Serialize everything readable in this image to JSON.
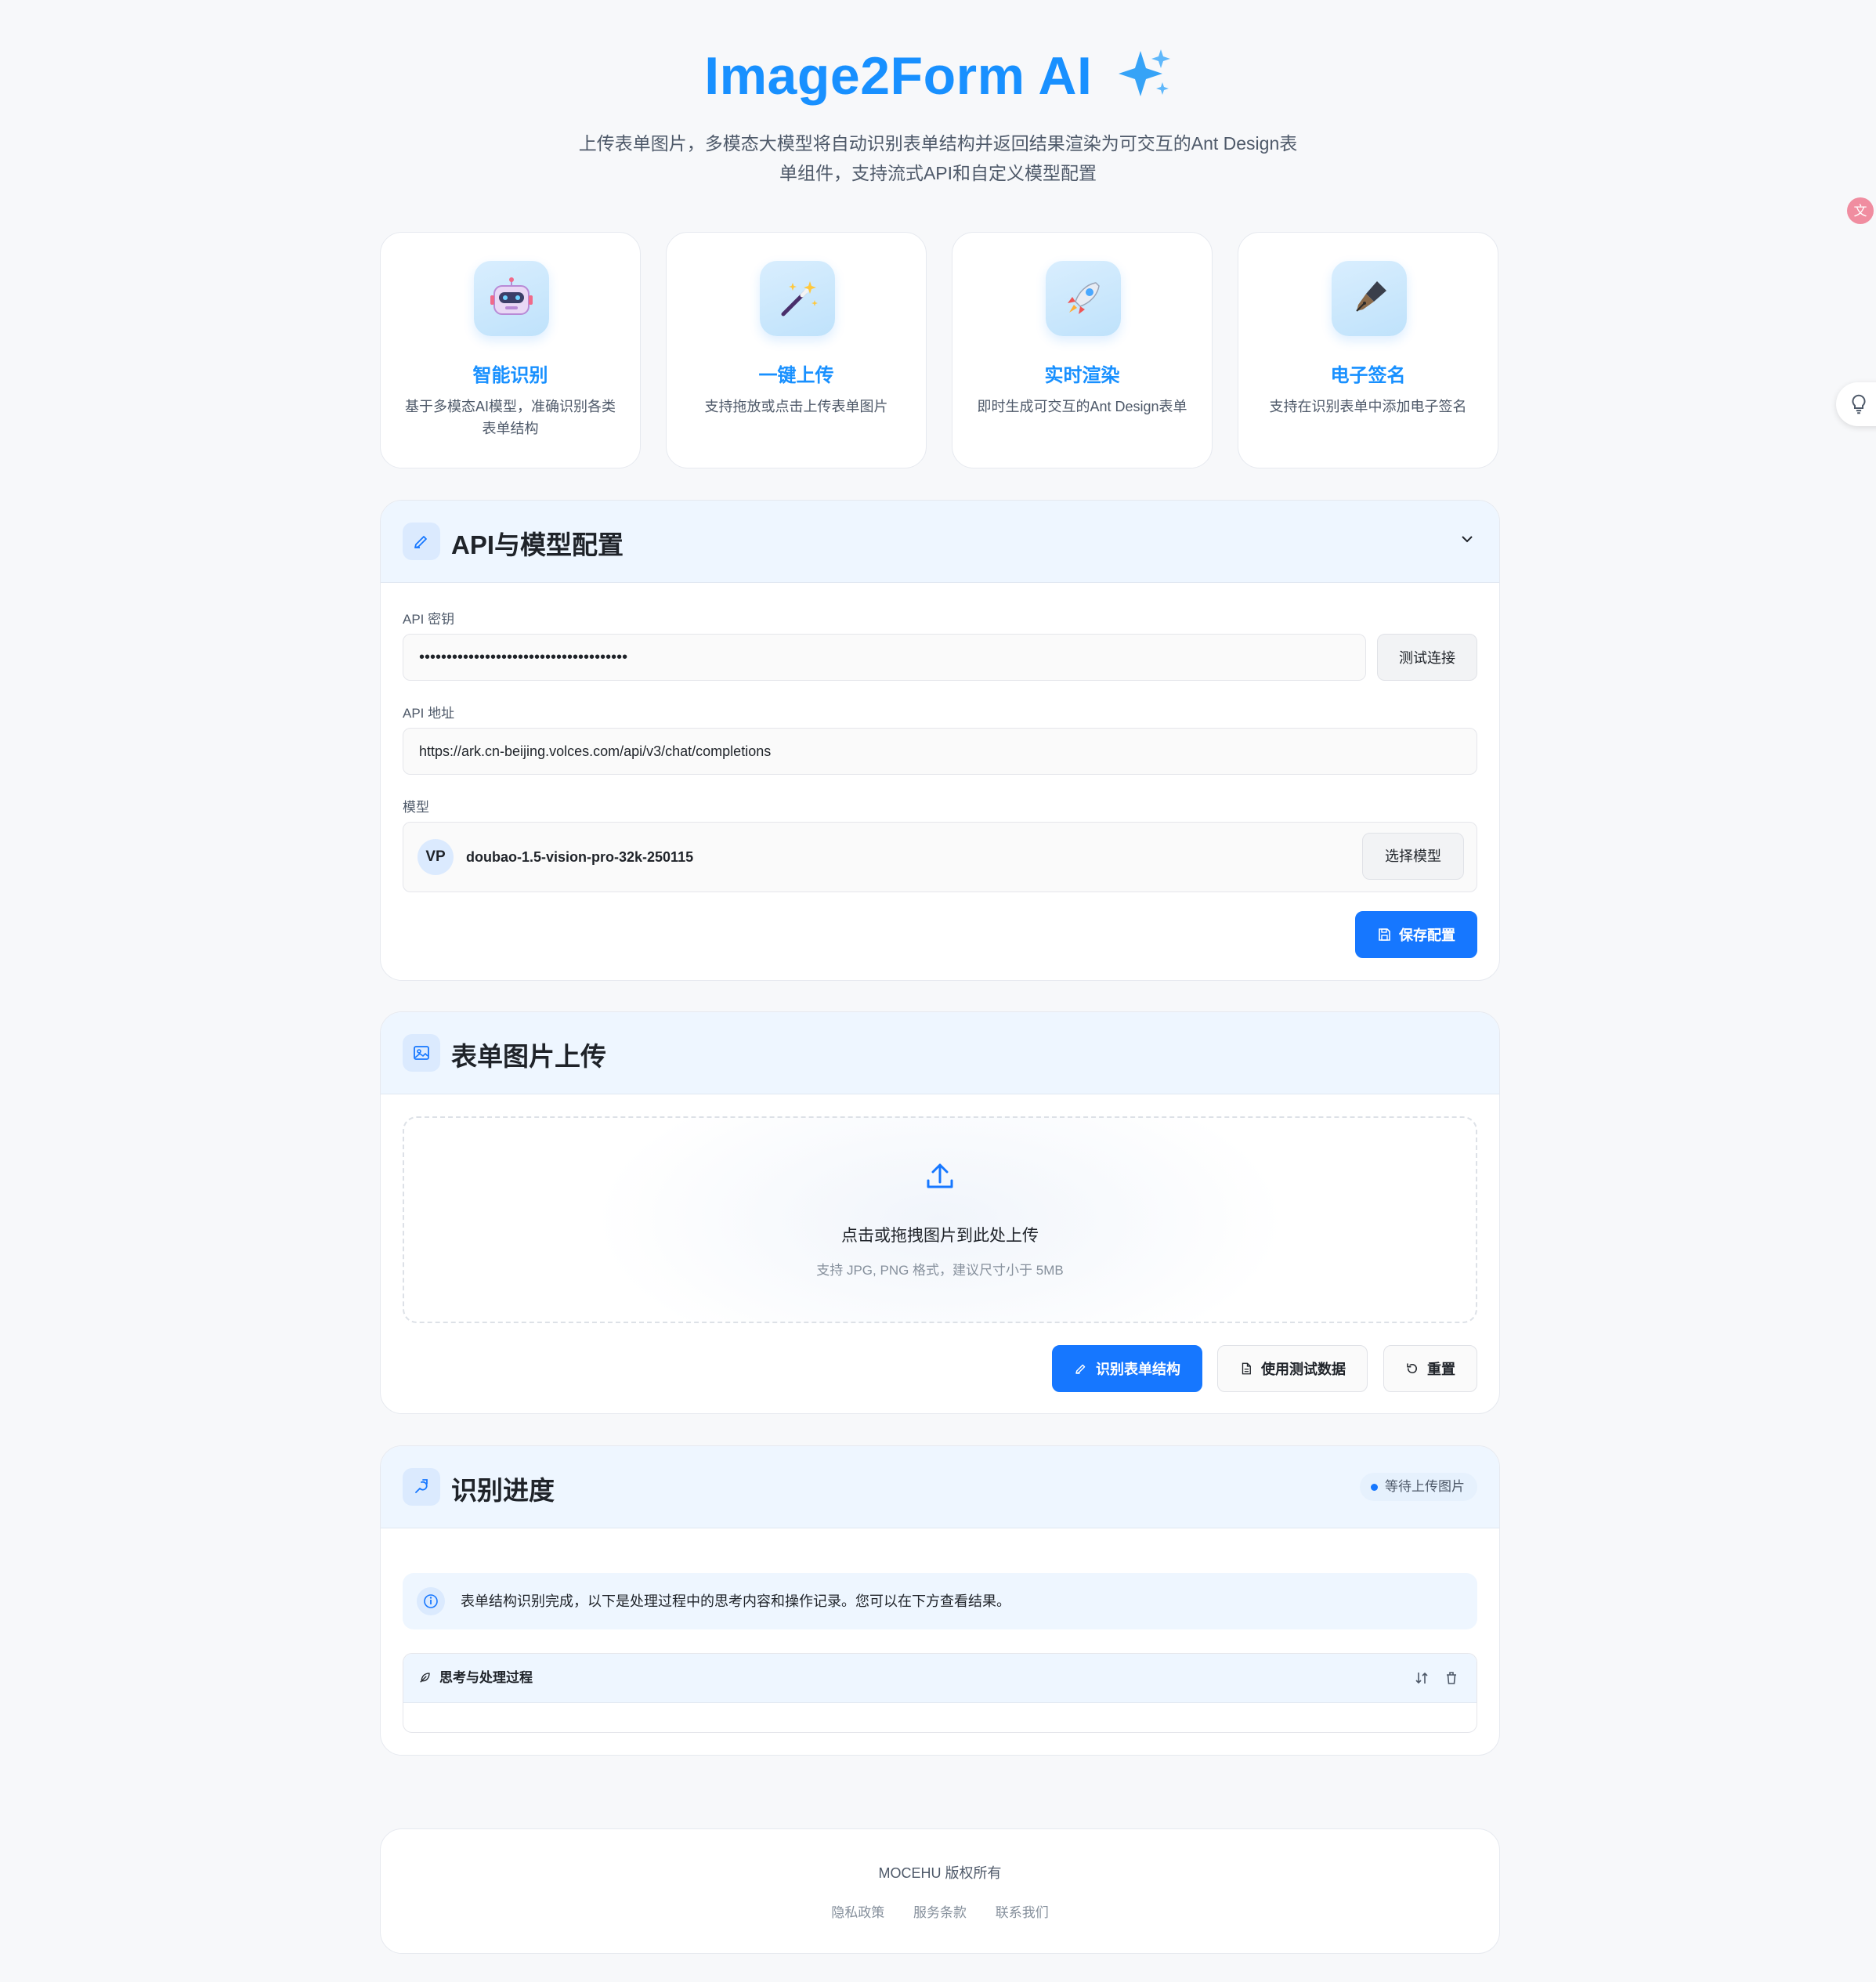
{
  "header": {
    "title": "Image2Form AI",
    "subtitle_line1": "上传表单图片，多模态大模型将自动识别表单结构并返回结果渲染为可交互的Ant Design表",
    "subtitle_line2": "单组件，支持流式API和自定义模型配置"
  },
  "features": [
    {
      "icon": "robot-icon",
      "title": "智能识别",
      "desc": "基于多模态AI模型，准确识别各类表单结构"
    },
    {
      "icon": "magic-wand-icon",
      "title": "一键上传",
      "desc": "支持拖放或点击上传表单图片"
    },
    {
      "icon": "rocket-icon",
      "title": "实时渲染",
      "desc": "即时生成可交互的Ant Design表单"
    },
    {
      "icon": "pen-icon",
      "title": "电子签名",
      "desc": "支持在识别表单中添加电子签名"
    }
  ],
  "config": {
    "title": "API与模型配置",
    "api_key_label": "API 密钥",
    "api_key_value": "••••••••••••••••••••••••••••••••••••••",
    "test_button": "测试连接",
    "api_url_label": "API 地址",
    "api_url_value": "https://ark.cn-beijing.volces.com/api/v3/chat/completions",
    "model_label": "模型",
    "model_avatar": "VP",
    "model_value": "doubao-1.5-vision-pro-32k-250115",
    "select_model_button": "选择模型",
    "save_button": "保存配置"
  },
  "upload": {
    "title": "表单图片上传",
    "drop_title": "点击或拖拽图片到此处上传",
    "drop_hint": "支持 JPG, PNG 格式，建议尺寸小于 5MB",
    "recognize_button": "识别表单结构",
    "test_data_button": "使用测试数据",
    "reset_button": "重置"
  },
  "progress": {
    "title": "识别进度",
    "status_badge": "等待上传图片",
    "info_text": "表单结构识别完成，以下是处理过程中的思考内容和操作记录。您可以在下方查看结果。",
    "process_title": "思考与处理过程"
  },
  "footer": {
    "copyright": "MOCEHU 版权所有",
    "links": [
      "隐私政策",
      "服务条款",
      "联系我们"
    ]
  },
  "colors": {
    "primary": "#1677ff",
    "title_blue": "#1890ff",
    "panel_header": "#eef6ff"
  }
}
